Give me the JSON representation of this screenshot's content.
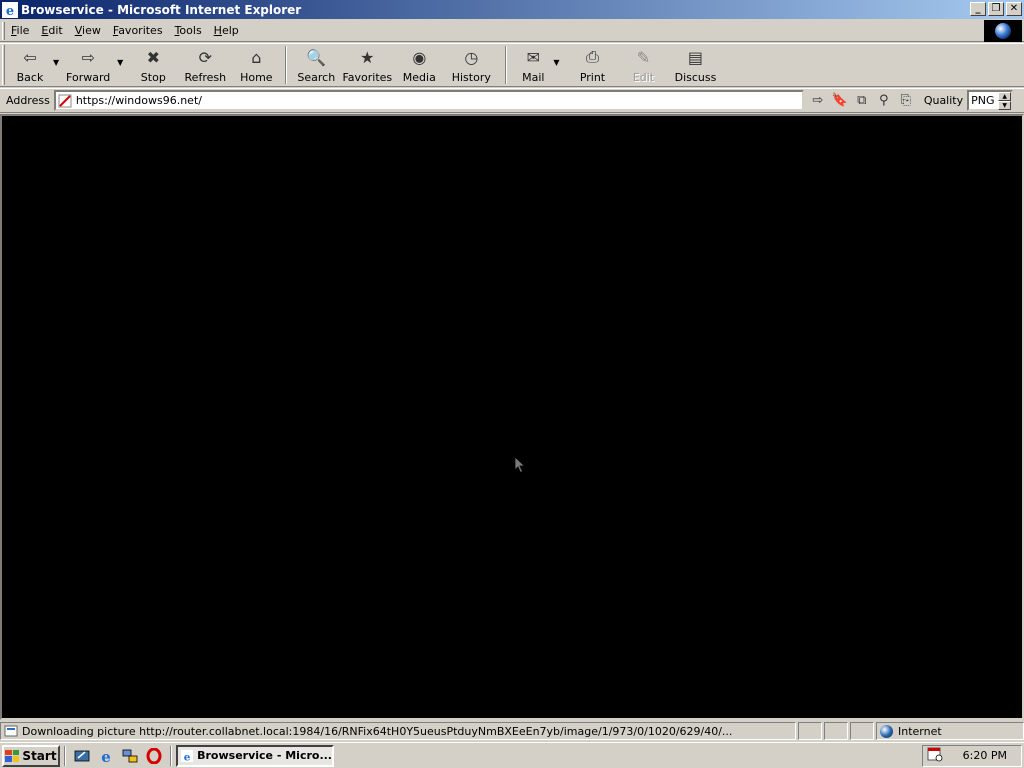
{
  "window": {
    "title": "Browservice - Microsoft Internet Explorer",
    "min_glyph": "_",
    "max_glyph": "❐",
    "close_glyph": "✕"
  },
  "menu": {
    "items": [
      {
        "label": "File"
      },
      {
        "label": "Edit"
      },
      {
        "label": "View"
      },
      {
        "label": "Favorites"
      },
      {
        "label": "Tools"
      },
      {
        "label": "Help"
      }
    ]
  },
  "toolbar": {
    "back": {
      "label": "Back",
      "icon": "⇦"
    },
    "forward": {
      "label": "Forward",
      "icon": "⇨"
    },
    "stop": {
      "label": "Stop",
      "icon": "✖"
    },
    "refresh": {
      "label": "Refresh",
      "icon": "⟳"
    },
    "home": {
      "label": "Home",
      "icon": "⌂"
    },
    "search": {
      "label": "Search",
      "icon": "🔍"
    },
    "favorites": {
      "label": "Favorites",
      "icon": "★"
    },
    "media": {
      "label": "Media",
      "icon": "◉"
    },
    "history": {
      "label": "History",
      "icon": "◷"
    },
    "mail": {
      "label": "Mail",
      "icon": "✉"
    },
    "print": {
      "label": "Print",
      "icon": "⎙"
    },
    "edit": {
      "label": "Edit",
      "icon": "✎"
    },
    "discuss": {
      "label": "Discuss",
      "icon": "▤"
    },
    "dropdown_glyph": "▼"
  },
  "address": {
    "label": "Address",
    "value": "https://windows96.net/",
    "go_icon": "⇨",
    "tool_icons": [
      "🔖",
      "⧉",
      "⚲",
      "⎘"
    ],
    "quality_label": "Quality",
    "quality_value": "PNG",
    "spin_up": "▲",
    "spin_down": "▼"
  },
  "status": {
    "text": "Downloading picture http://router.collabnet.local:1984/16/RNFix64tH0Y5ueusPtduyNmBXEeEn7yb/image/1/973/0/1020/629/40/...",
    "zone": "Internet"
  },
  "taskbar": {
    "start_label": "Start",
    "task_label": "Browservice - Micro...",
    "clock": "6:20 PM"
  }
}
